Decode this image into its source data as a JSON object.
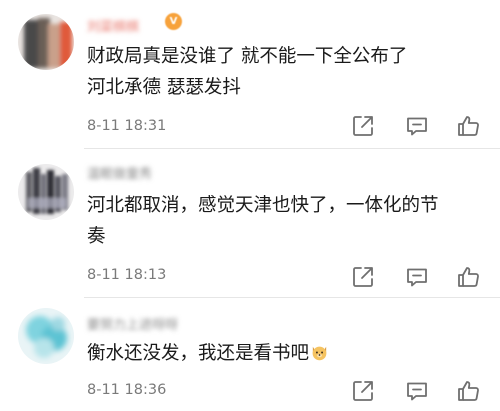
{
  "comments": [
    {
      "username": "刘菜棋棋",
      "has_vip_badge": true,
      "content_lines": [
        "财政局真是没谁了 就不能一下全公布了",
        "河北承德 瑟瑟发抖"
      ],
      "timestamp": "8-11 18:31"
    },
    {
      "username": "温眠做童秀",
      "has_vip_badge": false,
      "content_lines": [
        "河北都取消，感觉天津也快了，一体化的节",
        "奏"
      ],
      "timestamp": "8-11 18:13"
    },
    {
      "username": "要努力上进呀呀",
      "has_vip_badge": false,
      "content_lines": [
        "衡水还没发，我还是看书吧"
      ],
      "emoji": "dog-face-emoji",
      "timestamp": "8-11 18:36"
    }
  ],
  "actions": {
    "share_icon": "share-icon",
    "reply_icon": "comment-icon",
    "like_icon": "thumbs-up-icon"
  },
  "colors": {
    "text": "#1a1a1a",
    "meta": "#7a7a7a",
    "vip_name": "#e8766b",
    "icon": "#6f6f6f",
    "divider": "#e6e6e6"
  }
}
